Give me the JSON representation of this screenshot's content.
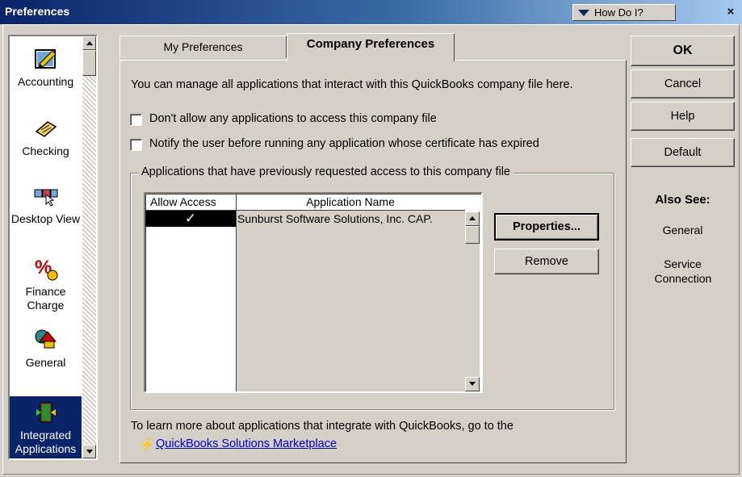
{
  "window": {
    "title": "Preferences",
    "how_do_i": "How Do I?",
    "close": "×"
  },
  "sidebar": {
    "items": [
      {
        "label": "Accounting",
        "icon": "accounting-pencil-icon"
      },
      {
        "label": "Checking",
        "icon": "checking-icon"
      },
      {
        "label": "Desktop View",
        "icon": "desktop-view-icon"
      },
      {
        "label": "Finance Charge",
        "icon": "finance-charge-icon"
      },
      {
        "label": "General",
        "icon": "general-shapes-icon"
      },
      {
        "label": "Integrated Applications",
        "icon": "integrated-apps-icon",
        "selected": true
      }
    ]
  },
  "tabs": [
    {
      "label": "My Preferences",
      "active": false
    },
    {
      "label": "Company Preferences",
      "active": true
    }
  ],
  "panel": {
    "description": "You can manage all applications that interact with this QuickBooks company file here.",
    "checkbox1": "Don't allow any applications to access this company file",
    "checkbox2": "Notify the user before running any application whose certificate has expired",
    "group_title": "Applications that have previously requested access to this company file",
    "list": {
      "columns": [
        "Allow Access",
        "Application Name"
      ],
      "rows": [
        {
          "allow": "✓",
          "name": "Sunburst Software Solutions, Inc. CAP."
        }
      ]
    },
    "properties_button": "Properties...",
    "remove_button": "Remove",
    "footer_text": "To learn more about applications that integrate with QuickBooks, go to the",
    "footer_link": "QuickBooks Solutions Marketplace"
  },
  "right_buttons": {
    "ok": "OK",
    "cancel": "Cancel",
    "help": "Help",
    "default": "Default"
  },
  "also_see": {
    "title": "Also See:",
    "links": [
      "General",
      "Service Connection"
    ]
  },
  "colors": {
    "selection": "#0a246a",
    "face": "#d4d0c8",
    "link": "#0000cc"
  }
}
